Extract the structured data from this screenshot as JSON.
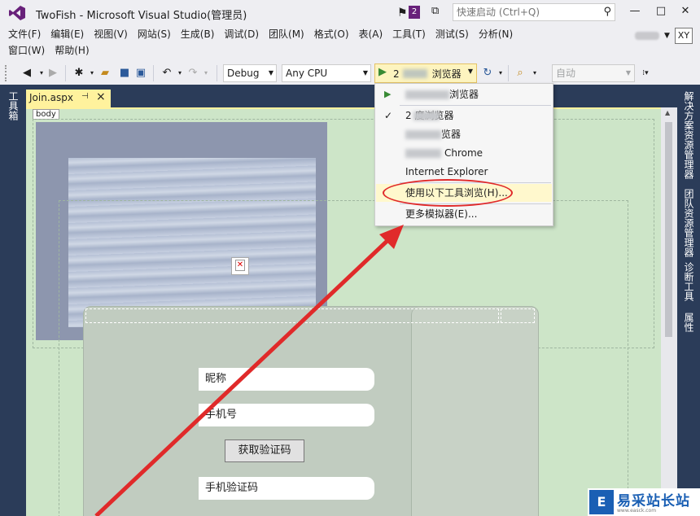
{
  "window": {
    "title": "TwoFish - Microsoft Visual Studio(管理员)",
    "notification_count": "2",
    "quick_launch_placeholder": "快速启动 (Ctrl+Q)",
    "user_initials": "XY"
  },
  "menu": {
    "row1": [
      "文件(F)",
      "编辑(E)",
      "视图(V)",
      "网站(S)",
      "生成(B)",
      "调试(D)",
      "团队(M)",
      "格式(O)",
      "表(A)",
      "工具(T)",
      "测试(S)",
      "分析(N)"
    ],
    "row2": [
      "窗口(W)",
      "帮助(H)"
    ]
  },
  "toolbar": {
    "config": "Debug",
    "platform": "Any CPU",
    "run_label": "2",
    "run_label_suffix": "浏览器",
    "auto": "自动"
  },
  "left_panel": {
    "label": "工具箱"
  },
  "right_panels": [
    "解决方案资源管理器",
    "团队资源管理器",
    "诊断工具",
    "属性"
  ],
  "editor": {
    "tab_name": "Join.aspx",
    "body_tag": "body",
    "fields": [
      "昵称",
      "手机号",
      "手机验证码"
    ],
    "code_button": "获取验证码"
  },
  "browse_menu": {
    "items": [
      {
        "label": "浏览器",
        "state": "run"
      },
      {
        "label": "2 度浏览器",
        "state": "checked"
      },
      {
        "label": "览器",
        "state": ""
      },
      {
        "label": "Chrome",
        "state": ""
      },
      {
        "label": "Internet Explorer",
        "state": ""
      },
      {
        "label": "使用以下工具浏览(H)...",
        "state": "highlighted"
      },
      {
        "label": "更多模拟器(E)...",
        "state": ""
      }
    ]
  },
  "watermark": {
    "logo_glyph": "E",
    "title": "易采站长站",
    "subtitle": "www.easck.com"
  },
  "colors": {
    "accent": "#68217a",
    "side_panel": "#2b3c59",
    "design_bg": "#cde5c8",
    "tab_active": "#fff29d",
    "annotation_red": "#e02a2a"
  }
}
